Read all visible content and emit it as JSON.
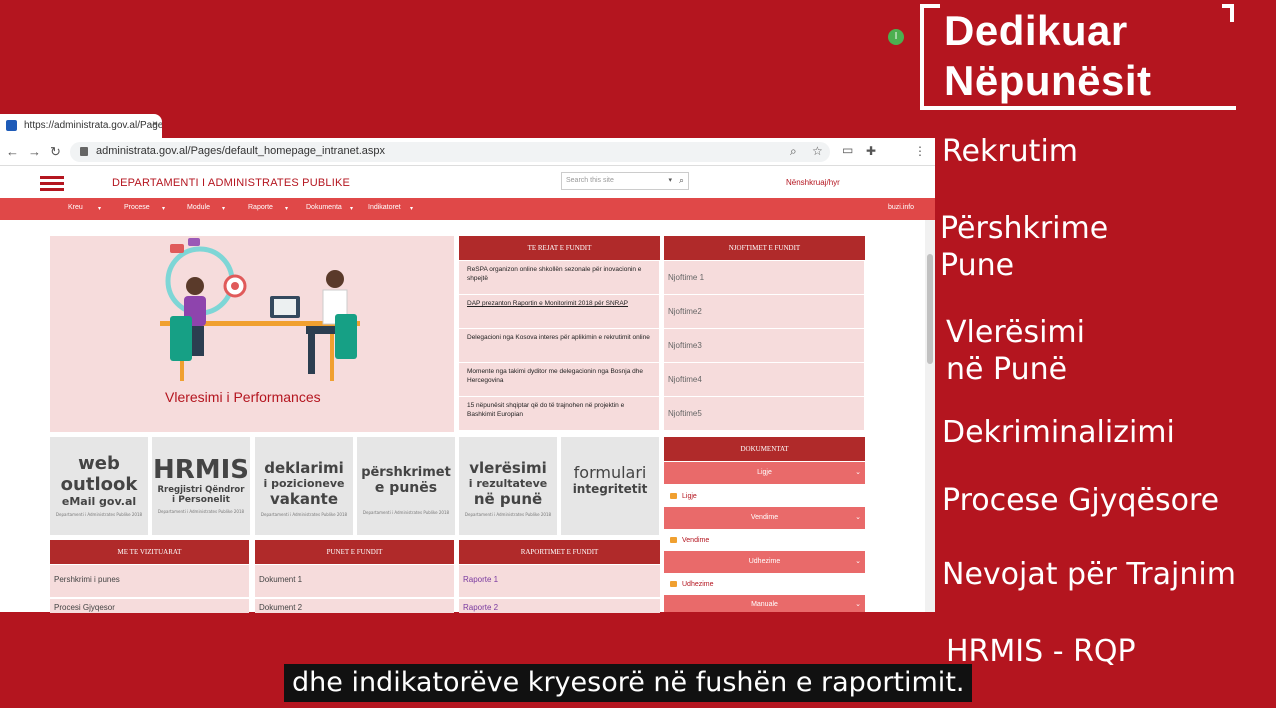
{
  "brand": {
    "line1": "Dedikuar",
    "line2": "Nëpunësit"
  },
  "topics": [
    "Rekrutim",
    "Përshkrime",
    "Pune",
    "Vlerësimi",
    "në Punë",
    "Dekriminalizimi",
    "Procese Gjyqësore",
    "Nevojat për Trajnim",
    "HRMIS - RQP"
  ],
  "caption": "dhe indikatorëve kryesorë në fushën e raportimit.",
  "browser": {
    "tab_title": "https://administrata.gov.al/Pages/",
    "tab_close": "×",
    "url": "administrata.gov.al/Pages/default_homepage_intranet.aspx",
    "avatar_letter": "I"
  },
  "site": {
    "title": "DEPARTAMENTI I ADMINISTRATES PUBLIKE",
    "search_placeholder": "Search this site",
    "signin": "Nënshkruaj/hyr",
    "menu": [
      "Kreu",
      "Procese",
      "Module",
      "Raporte",
      "Dokumenta",
      "Indikatoret"
    ],
    "user": "buzi.info"
  },
  "hero": {
    "title": "Vleresimi i Performances"
  },
  "news": {
    "header": "TE REJAT E FUNDIT",
    "items": [
      "ReSPA organizon online shkollën sezonale për inovacionin e shpejtë",
      "DAP prezanton Raportin e Monitorimit 2018 për SNRAP",
      "Delegacioni nga Kosova interes për aplikimin e rekrutimit online",
      "Momente nga takimi dyditor me delegacionin nga Bosnja dhe Hercegovina",
      "15 nëpunësit shqiptar që do të trajnohen në projektin e Bashkimit Europian"
    ]
  },
  "notices": {
    "header": "NJOFTIMET E FUNDIT",
    "items": [
      "Njoftime 1",
      "Njoftime2",
      "Njoftime3",
      "Njoftime4",
      "Njoftime5"
    ]
  },
  "tiles": [
    {
      "l1": "web",
      "l2": "outlook",
      "l3": "eMail gov.al",
      "small": "Departamenti i Administrates Publike 2018"
    },
    {
      "l1": "HRMIS",
      "l2": "Rregjistri Qëndror",
      "l3": "i Personelit",
      "small": "Departamenti i Administrates Publike 2018"
    },
    {
      "l1": "deklarimi",
      "l2": "i pozicioneve",
      "l3": "vakante",
      "small": "Departamenti i Administrates Publike 2018"
    },
    {
      "l1": "përshkrimet",
      "l2": "e punës",
      "l3": "",
      "small": "Departamenti i Administrates Publike 2018"
    },
    {
      "l1": "vlerësimi",
      "l2": "i rezultateve",
      "l3": "në punë",
      "small": "Departamenti i Administrates Publike 2018"
    },
    {
      "l1": "formulari",
      "l2": "integritetit",
      "l3": "",
      "small": ""
    }
  ],
  "documents": {
    "header": "DOKUMENTAT",
    "selects": [
      "Ligje",
      "Vendime",
      "Udhezime",
      "Manuale"
    ],
    "folders": [
      "Ligje",
      "Vendime",
      "Udhezime"
    ]
  },
  "visited": {
    "header": "ME TE VIZITUARAT",
    "items": [
      "Pershkrimi i punes",
      "Procesi Gjyqesor"
    ]
  },
  "jobs": {
    "header": "PUNET E FUNDIT",
    "items": [
      "Dokument 1",
      "Dokument 2"
    ]
  },
  "reports": {
    "header": "RAPORTIMET E FUNDIT",
    "items": [
      "Raporte 1",
      "Raporte 2"
    ]
  }
}
